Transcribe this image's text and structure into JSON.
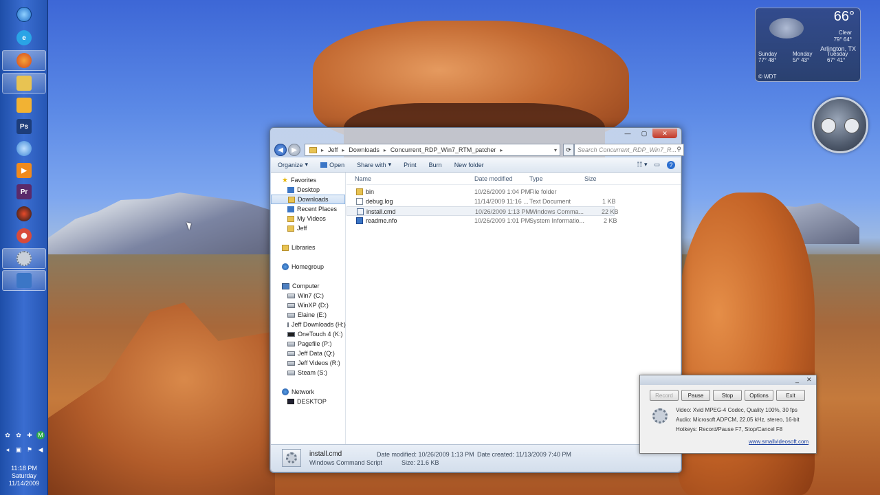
{
  "taskbar": {
    "icons": [
      {
        "name": "start-orb-icon",
        "color": "#2e8ae6"
      },
      {
        "name": "internet-explorer-icon",
        "color": "#2aa4e6"
      },
      {
        "name": "firefox-icon",
        "color": "#e5681c"
      },
      {
        "name": "windows-explorer-icon",
        "color": "#e8c352"
      },
      {
        "name": "outlook-icon",
        "color": "#f2b233"
      },
      {
        "name": "photoshop-icon",
        "color": "#1d3d7a",
        "text": "Ps"
      },
      {
        "name": "paint-icon",
        "color": "#6fb0e8"
      },
      {
        "name": "media-player-icon",
        "color": "#f08a1c"
      },
      {
        "name": "premiere-icon",
        "color": "#5a2a6a",
        "text": "Pr"
      },
      {
        "name": "media-center-icon",
        "color": "#2a2a2a"
      },
      {
        "name": "chrome-icon",
        "color": "#d84a3a"
      },
      {
        "name": "recorder-icon",
        "color": "#c9d0da"
      },
      {
        "name": "remote-desktop-icon",
        "color": "#3b76c6"
      }
    ],
    "clock": {
      "time": "11:18 PM",
      "day": "Saturday",
      "date": "11/14/2009"
    }
  },
  "weather": {
    "temp": "66°",
    "condition": "Clear",
    "hi_lo": "79° 64°",
    "city": "Arlington, TX",
    "days": [
      {
        "name": "Sunday",
        "temps": "77° 48°"
      },
      {
        "name": "Monday",
        "temps": "5/° 43°"
      },
      {
        "name": "Tuesday",
        "temps": "67° 41°"
      }
    ],
    "source": "© WDT"
  },
  "explorer": {
    "breadcrumb": [
      "Jeff",
      "Downloads",
      "Concurrent_RDP_Win7_RTM_patcher"
    ],
    "search_placeholder": "Search Concurrent_RDP_Win7_R...",
    "toolbar": {
      "organize": "Organize",
      "open": "Open",
      "share_with": "Share with",
      "print": "Print",
      "burn": "Burn",
      "new_folder": "New folder"
    },
    "nav": {
      "favorites": "Favorites",
      "fav_items": [
        "Desktop",
        "Downloads",
        "Recent Places",
        "My Videos",
        "Jeff"
      ],
      "libraries": "Libraries",
      "homegroup": "Homegroup",
      "computer": "Computer",
      "drives": [
        "Win7 (C:)",
        "WinXP (D:)",
        "Elaine (E:)",
        "Jeff Downloads (H:)",
        "OneTouch 4 (K:)",
        "Pagefile (P:)",
        "Jeff Data (Q:)",
        "Jeff Videos (R:)",
        "Steam (S:)"
      ],
      "network": "Network",
      "network_items": [
        "DESKTOP"
      ]
    },
    "columns": {
      "name": "Name",
      "date": "Date modified",
      "type": "Type",
      "size": "Size"
    },
    "files": [
      {
        "name": "bin",
        "date": "10/26/2009 1:04 PM",
        "type": "File folder",
        "size": ""
      },
      {
        "name": "debug.log",
        "date": "11/14/2009 11:16 ...",
        "type": "Text Document",
        "size": "1 KB"
      },
      {
        "name": "install.cmd",
        "date": "10/26/2009 1:13 PM",
        "type": "Windows Comma...",
        "size": "22 KB"
      },
      {
        "name": "readme.nfo",
        "date": "10/26/2009 1:01 PM",
        "type": "System Informatio...",
        "size": "2 KB"
      }
    ],
    "details": {
      "filename": "install.cmd",
      "filetype": "Windows Command Script",
      "modified": "Date modified: 10/26/2009 1:13 PM",
      "size": "Size: 21.6 KB",
      "created": "Date created: 11/13/2009 7:40 PM"
    }
  },
  "recorder": {
    "buttons": {
      "record": "Record",
      "pause": "Pause",
      "stop": "Stop",
      "options": "Options",
      "exit": "Exit"
    },
    "video": "Video: Xvid MPEG-4 Codec, Quality 100%, 30 fps",
    "audio": "Audio: Microsoft ADPCM, 22.05 kHz, stereo, 16-bit",
    "hotkeys": "Hotkeys: Record/Pause F7, Stop/Cancel F8",
    "link": "www.smallvideosoft.com"
  }
}
